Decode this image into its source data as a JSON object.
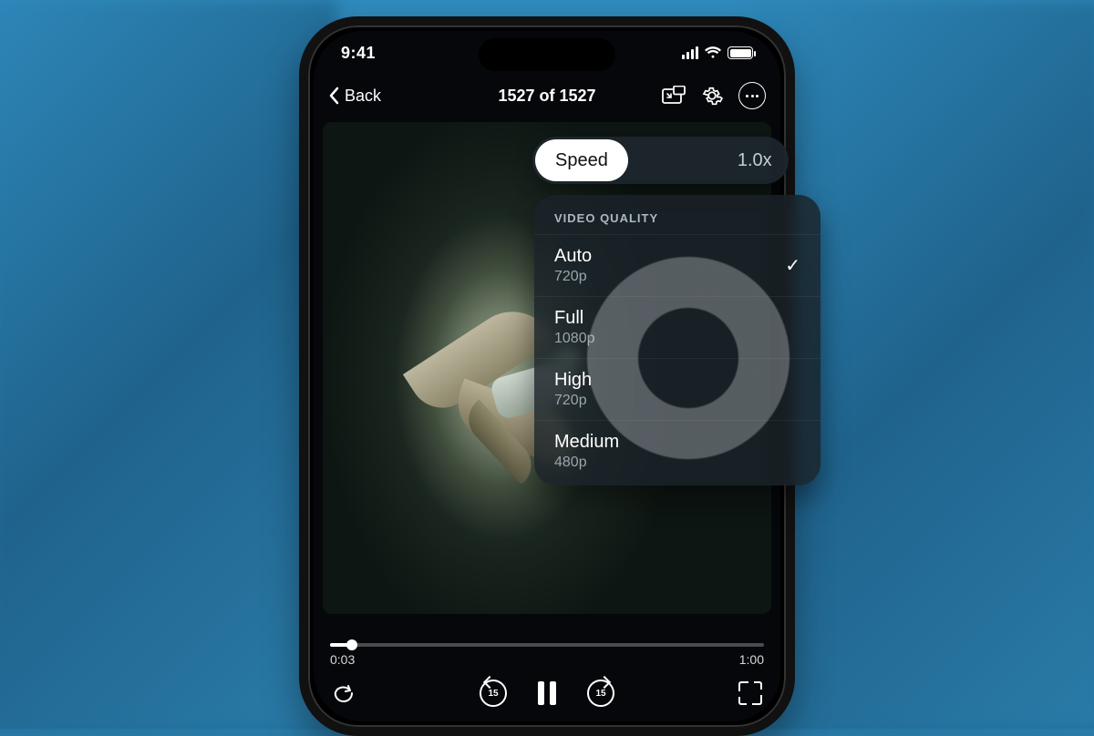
{
  "status": {
    "time": "9:41"
  },
  "nav": {
    "back_label": "Back",
    "title": "1527 of 1527"
  },
  "speed": {
    "label": "Speed",
    "value": "1.0x"
  },
  "quality": {
    "header": "VIDEO QUALITY",
    "items": [
      {
        "name": "Auto",
        "sub": "720p",
        "selected": true
      },
      {
        "name": "Full",
        "sub": "1080p",
        "selected": false
      },
      {
        "name": "High",
        "sub": "720p",
        "selected": false
      },
      {
        "name": "Medium",
        "sub": "480p",
        "selected": false
      }
    ]
  },
  "playback": {
    "elapsed": "0:03",
    "total": "1:00",
    "skip_back_seconds": "15",
    "skip_fwd_seconds": "15"
  }
}
